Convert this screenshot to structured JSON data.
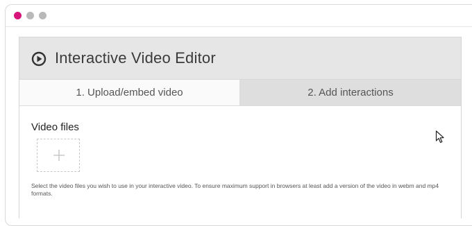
{
  "window": {
    "controls": [
      "close",
      "minimize",
      "maximize"
    ],
    "colors": {
      "close": "#d6157d",
      "minimize": "#b9b9b9",
      "maximize": "#b9b9b9"
    }
  },
  "editor": {
    "title": "Interactive Video Editor",
    "title_icon": "play-circle-icon",
    "tabs": [
      {
        "label": "1. Upload/embed video",
        "active": true
      },
      {
        "label": "2. Add interactions",
        "active": false
      }
    ],
    "video_files": {
      "label": "Video files",
      "add_icon": "plus-icon",
      "help_text": "Select the video files you wish to use in your interactive video. To ensure maximum support in browsers at least add a version of the video in webm and mp4 formats."
    }
  },
  "cursor": {
    "icon": "mouse-pointer-icon"
  }
}
